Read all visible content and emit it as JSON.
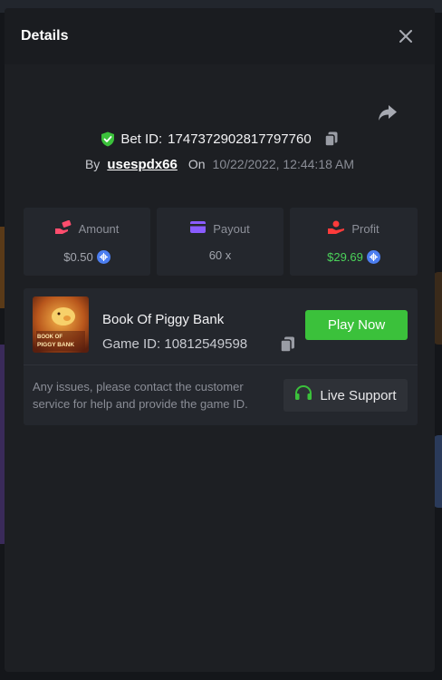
{
  "modal": {
    "title": "Details"
  },
  "bet": {
    "label": "Bet ID:",
    "id": "1747372902817797760",
    "by_label": "By",
    "user": "usespdx66",
    "on_label": "On",
    "date": "10/22/2022, 12:44:18 AM"
  },
  "stats": {
    "amount": {
      "label": "Amount",
      "value": "$0.50"
    },
    "payout": {
      "label": "Payout",
      "value": "60 x"
    },
    "profit": {
      "label": "Profit",
      "value": "$29.69"
    }
  },
  "game": {
    "thumb_text_1": "BOOK OF",
    "thumb_text_2": "PIGGY BANK",
    "name": "Book Of Piggy Bank",
    "id_label": "Game ID:",
    "id": "10812549598",
    "play_label": "Play Now"
  },
  "support": {
    "text": "Any issues, please contact the customer service for help and provide the game ID.",
    "button_label": "Live Support"
  },
  "icons": {
    "close": "close-icon",
    "share": "share-icon",
    "shield": "shield-check-icon",
    "copy": "copy-icon",
    "amount": "hand-money-icon",
    "payout": "card-icon",
    "profit": "profit-hand-icon",
    "coin": "coin-icon",
    "headset": "headset-icon"
  },
  "colors": {
    "accent_green": "#3bc13b",
    "profit_green": "#4bd25a",
    "coin_blue": "#4c7ef0",
    "amount_icon": "#ff4d6d",
    "payout_icon": "#8a5cff",
    "profit_icon": "#ff3b3b"
  }
}
